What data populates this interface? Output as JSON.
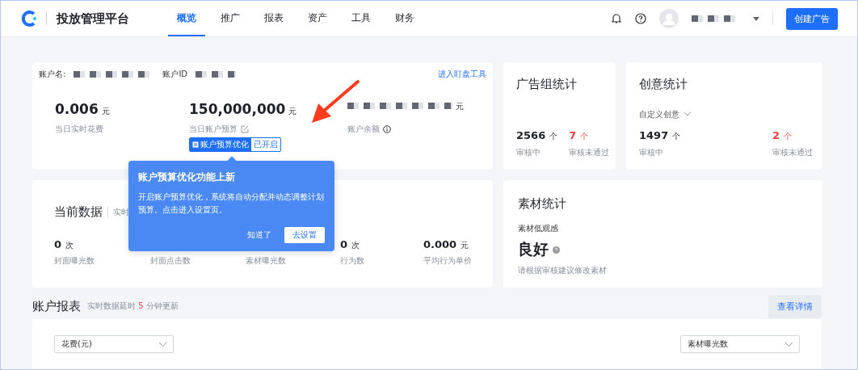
{
  "header": {
    "brand": "投放管理平台",
    "nav": [
      {
        "label": "概览",
        "selected": true
      },
      {
        "label": "推广",
        "selected": false
      },
      {
        "label": "报表",
        "selected": false
      },
      {
        "label": "资产",
        "selected": false
      },
      {
        "label": "工具",
        "selected": false
      },
      {
        "label": "财务",
        "selected": false
      }
    ],
    "create_button": "创建广告"
  },
  "account": {
    "name_label": "账户名:",
    "id_label": "账户ID",
    "tool_link": "进入盯盘工具",
    "metrics": [
      {
        "value": "0.006",
        "unit": "元",
        "label": "当日实时花费",
        "kind": "plain"
      },
      {
        "value": "150,000,000",
        "unit": "元",
        "label": "当日账户预算",
        "kind": "editable"
      },
      {
        "unit": "元",
        "label": "账户余额",
        "kind": "info"
      }
    ],
    "tag": {
      "label": "账户预算优化",
      "status": "已开启"
    }
  },
  "adgroup_stats": {
    "title": "广告组统计",
    "items": [
      {
        "value": "2566",
        "unit": "个",
        "label": "审核中",
        "alert": false
      },
      {
        "value": "7",
        "unit": "个",
        "label": "审核未通过",
        "alert": true
      }
    ]
  },
  "creative_stats": {
    "title": "创意统计",
    "filter": "自定义创意",
    "items": [
      {
        "value": "1497",
        "unit": "个",
        "label": "审核中",
        "alert": false
      },
      {
        "value": "2",
        "unit": "个",
        "label": "审核未通过",
        "alert": true
      }
    ]
  },
  "current_data": {
    "title": "当前数据",
    "subtitle": "实时",
    "metrics": [
      {
        "value": "0",
        "unit": "次",
        "label": "封面曝光数"
      },
      {
        "label": "封面点击数"
      },
      {
        "label": "素材曝光数"
      },
      {
        "value": "0",
        "unit": "次",
        "label": "行为数"
      },
      {
        "value": "0.000",
        "unit": "元",
        "label": "平均行为单价"
      }
    ]
  },
  "material_stats": {
    "title": "素材统计",
    "subtitle": "素材低观感",
    "status": "良好",
    "hint": "请根据审核建议修改素材"
  },
  "report": {
    "title": "账户报表",
    "note_before": "实时数据延时",
    "delay": "5",
    "note_after": "分钟更新",
    "details_button": "查看详情",
    "left_select": "花费(元)",
    "right_select": "素材曝光数"
  },
  "popover": {
    "title": "账户预算优化功能上新",
    "body": "开启账户预算优化，系统将自动分配并动态调整计划预算。点击进入设置页。",
    "dismiss": "知道了",
    "confirm": "去设置"
  }
}
